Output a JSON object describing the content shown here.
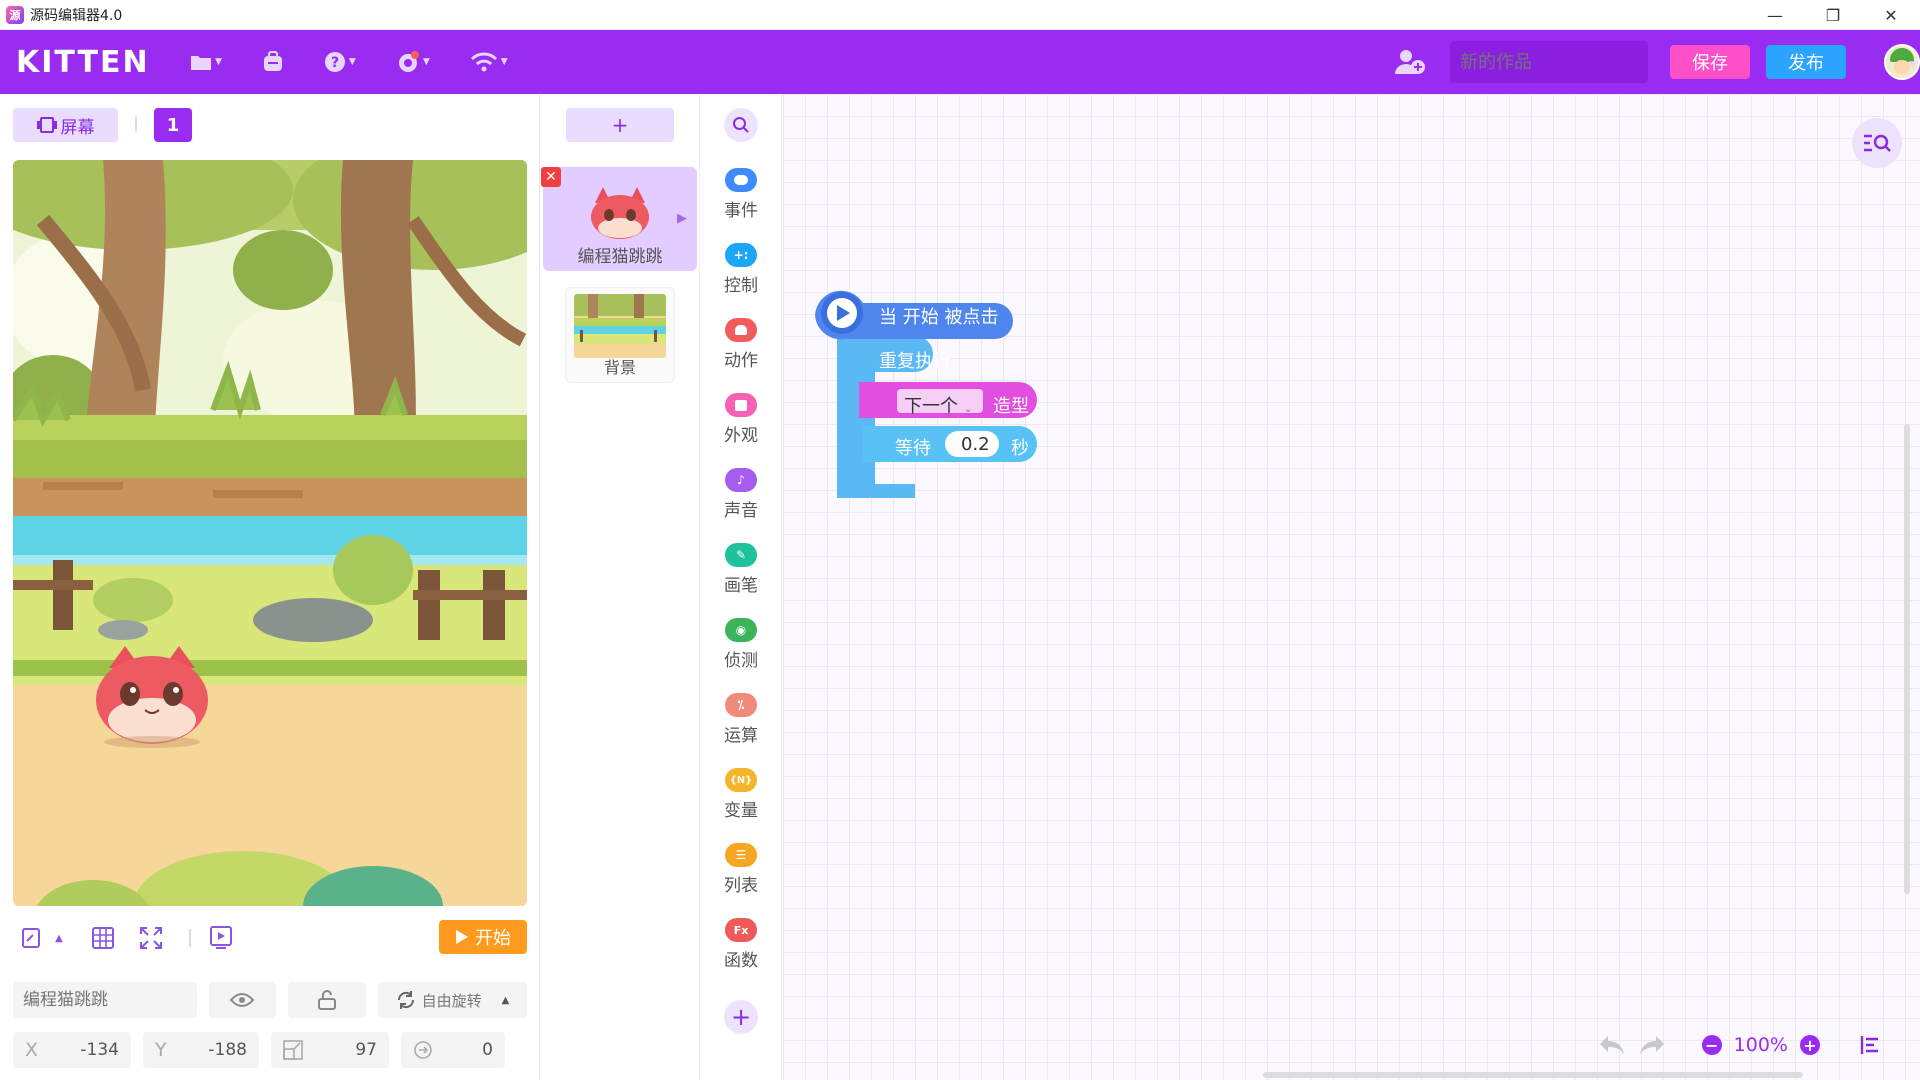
{
  "window": {
    "title": "源码编辑器4.0",
    "controls": {
      "minimize": "—",
      "restore": "❐",
      "close": "✕"
    }
  },
  "topnav": {
    "logo": "KITTEN",
    "icons": [
      "folder-icon",
      "backpack-icon",
      "help-icon",
      "settings-icon",
      "wifi-icon"
    ],
    "work_title_placeholder": "新的作品",
    "save_label": "保存",
    "publish_label": "发布"
  },
  "stage_panel": {
    "screen_label": "屏幕",
    "screen_number": "1",
    "start_label": "开始",
    "sprite_name_placeholder": "编程猫跳跳",
    "rotation_label": "自由旋转",
    "x_label": "X",
    "x_value": "-134",
    "y_label": "Y",
    "y_value": "-188",
    "size_value": "97",
    "direction_value": "0"
  },
  "sprites": {
    "add_label": "+",
    "items": [
      {
        "name": "编程猫跳跳",
        "selected": true
      },
      {
        "name": "背景",
        "selected": false
      }
    ]
  },
  "categories": [
    {
      "label": "事件",
      "color": "#3d8bff",
      "glyph": ""
    },
    {
      "label": "控制",
      "color": "#1aa7f5",
      "glyph": "+:"
    },
    {
      "label": "动作",
      "color": "#f25b5b",
      "glyph": ""
    },
    {
      "label": "外观",
      "color": "#f562b4",
      "glyph": ""
    },
    {
      "label": "声音",
      "color": "#a55cf0",
      "glyph": "♪"
    },
    {
      "label": "画笔",
      "color": "#1fc29a",
      "glyph": "✎"
    },
    {
      "label": "侦测",
      "color": "#3cb55a",
      "glyph": "◉"
    },
    {
      "label": "运算",
      "color": "#f08a7a",
      "glyph": "⁒"
    },
    {
      "label": "变量",
      "color": "#f5b52a",
      "glyph": "{N}"
    },
    {
      "label": "列表",
      "color": "#f5a623",
      "glyph": "☰"
    },
    {
      "label": "函数",
      "color": "#ee5a5a",
      "glyph": "Fx"
    }
  ],
  "script": {
    "hat_label": "当 开始 被点击",
    "loop_label": "重复执行",
    "costume_dropdown": "下一个",
    "costume_label": "造型",
    "wait_label": "等待",
    "wait_value": "0.2",
    "wait_unit": "秒"
  },
  "workspace": {
    "zoom": "100%"
  }
}
